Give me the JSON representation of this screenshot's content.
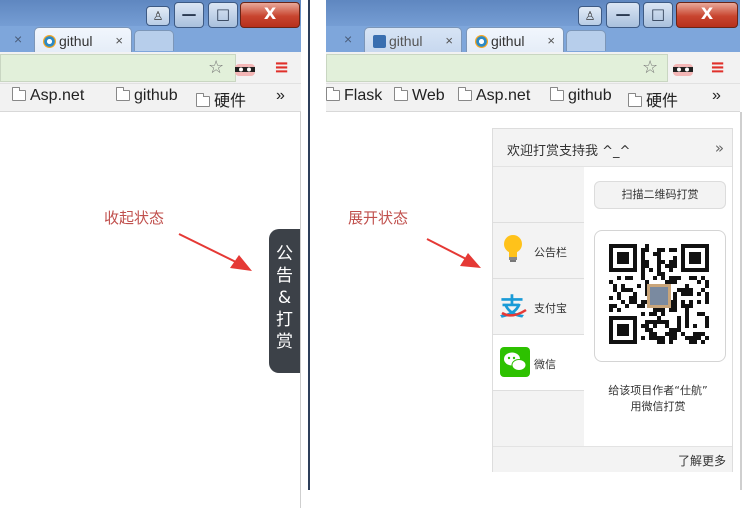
{
  "left_browser": {
    "tabs": [
      {
        "label": "githul",
        "active": true
      }
    ],
    "partial_tab_close": "×",
    "tab_close": "×",
    "bookmarks": [
      {
        "label": "Asp.net"
      },
      {
        "label": "github"
      },
      {
        "label": "硬件"
      }
    ],
    "bookmarks_overflow": "»"
  },
  "right_browser": {
    "tabs": [
      {
        "label": "githul",
        "active": false
      },
      {
        "label": "githul",
        "active": true
      }
    ],
    "partial_tab_close": "×",
    "tab_close": "×",
    "bookmarks": [
      {
        "label": "Flask"
      },
      {
        "label": "Web"
      },
      {
        "label": "Asp.net"
      },
      {
        "label": "github"
      },
      {
        "label": "硬件"
      }
    ],
    "bookmarks_overflow": "»"
  },
  "window_controls": {
    "minimize": "—",
    "maximize": "□",
    "close": "X"
  },
  "toolbar_icons": {
    "star": "☆",
    "menu": "≡"
  },
  "captions": {
    "collapsed": "收起状态",
    "expanded": "展开状态"
  },
  "notice_tab": {
    "chars": [
      "公",
      "告",
      "&",
      "打",
      "赏"
    ]
  },
  "panel": {
    "title": "欢迎打赏支持我 ^_^",
    "collapse": "»",
    "sidebar": [
      {
        "label": "公告栏",
        "icon": "lightbulb-icon"
      },
      {
        "label": "支付宝",
        "icon": "alipay-icon"
      },
      {
        "label": "微信",
        "icon": "wechat-icon",
        "active": true
      }
    ],
    "scan_button": "扫描二维码打赏",
    "qr_caption_line1": "给该项目作者“仕航”",
    "qr_caption_line2": "用微信打赏",
    "footer_link": "了解更多"
  },
  "colors": {
    "caption": "#c0504d",
    "arrow": "#e53935",
    "notice_tab_bg": "#3c4148",
    "omnibox": "#e2f0da"
  }
}
